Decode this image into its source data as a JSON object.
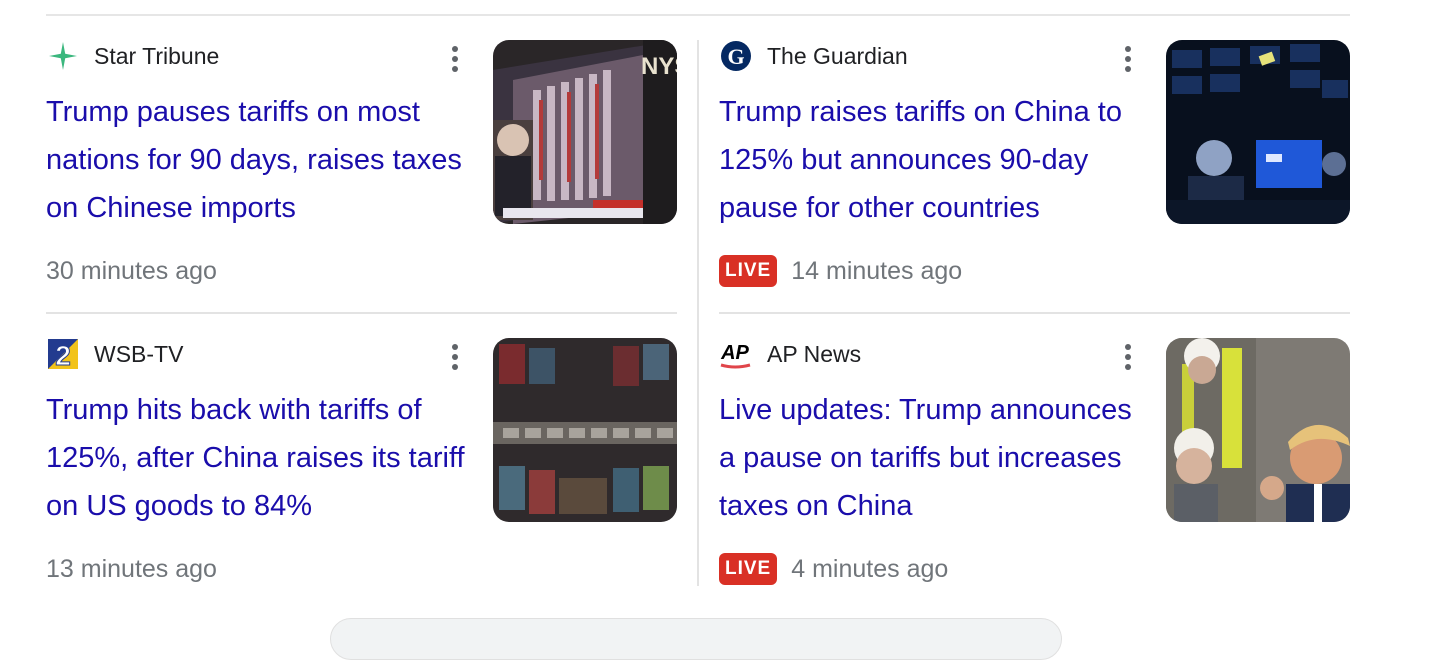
{
  "stories": [
    {
      "source": "Star Tribune",
      "logo_icon": "star-tribune-logo-icon",
      "title": "Trump pauses tariffs on most nations for 90 days, raises taxes on Chinese imports",
      "time": "30 minutes ago",
      "live": null,
      "thumbnail": "nyse-trading-floor-screens"
    },
    {
      "source": "The Guardian",
      "logo_icon": "guardian-logo-icon",
      "title": "Trump raises tariffs on China to 125% but announces 90-day pause for other countries",
      "time": "14 minutes ago",
      "live": "LIVE",
      "thumbnail": "trader-at-dark-screens"
    },
    {
      "source": "WSB-TV",
      "logo_icon": "wsb-tv-logo-icon",
      "title": "Trump hits back with tariffs of 125%, after China raises its tariff on US goods to 84%",
      "time": "13 minutes ago",
      "live": null,
      "thumbnail": "shipping-containers-aerial"
    },
    {
      "source": "AP News",
      "logo_icon": "ap-logo-icon",
      "logo_text": "AP",
      "title": "Live updates: Trump announces a pause on tariffs but increases taxes on China",
      "time": "4 minutes ago",
      "live": "LIVE",
      "thumbnail": "trump-with-workers"
    }
  ],
  "colors": {
    "title_link": "#1a0dab",
    "live_badge": "#d93025",
    "meta_text": "#70757a"
  }
}
